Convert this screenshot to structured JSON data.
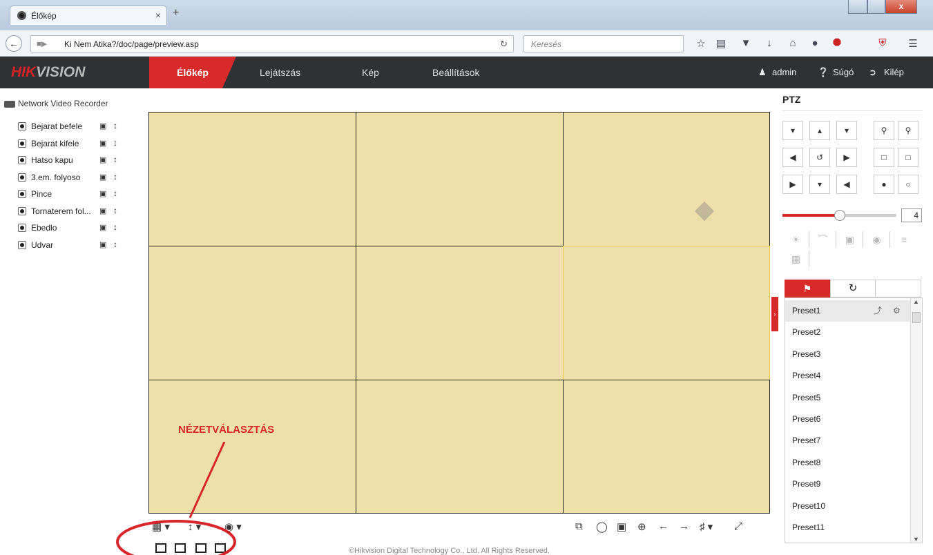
{
  "browser": {
    "tab_title": "Élőkép",
    "tab_close": "×",
    "new_tab": "+",
    "url": "Ki Nem Atika?/doc/page/preview.asp",
    "search_placeholder": "Keresés"
  },
  "hik": {
    "logo_red": "HIK",
    "logo_grey": "VISION",
    "nav": [
      "Élőkép",
      "Lejátszás",
      "Kép",
      "Beállítások"
    ],
    "user": "admin",
    "help": "Súgó",
    "logout": "Kilép"
  },
  "device": {
    "name": "Network Video Recorder"
  },
  "cameras": [
    "Bejarat befele",
    "Bejarat kifele",
    "Hatso kapu",
    "3.em. folyoso",
    "Pince",
    "Tornaterem fol...",
    "Ebedlo",
    "Udvar"
  ],
  "annotation": "NÉZETVÁLASZTÁS",
  "footer": "©Hikvision Digital Technology Co., Ltd. All Rights Reserved.",
  "ptz": {
    "title": "PTZ",
    "speed": "4",
    "speed_fraction": 0.5,
    "presets": [
      "Preset1",
      "Preset2",
      "Preset3",
      "Preset4",
      "Preset5",
      "Preset6",
      "Preset7",
      "Preset8",
      "Preset9",
      "Preset10",
      "Preset11"
    ]
  },
  "colors": {
    "accent": "#d82b29",
    "video_bg": "#efdfab",
    "nav_bg": "#2f3135"
  }
}
